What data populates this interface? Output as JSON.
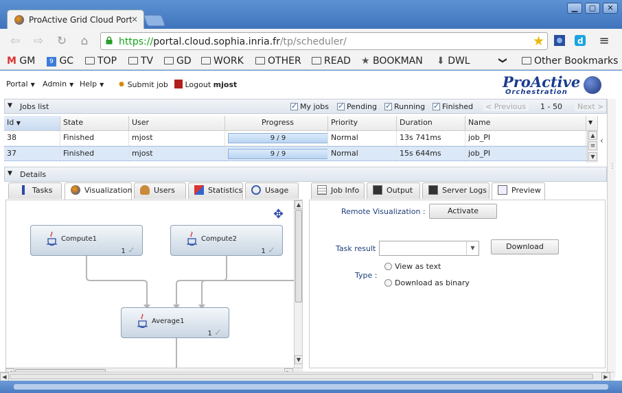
{
  "browser": {
    "tab_title": "ProActive Grid Cloud Port",
    "tab_close": "×",
    "url_scheme": "https://",
    "url_host": "portal.cloud.sophia.inria.fr",
    "url_path": "/tp/scheduler/",
    "window_buttons": [
      "▁",
      "▢",
      "✕"
    ],
    "nav": {
      "back": "⇦",
      "forward": "⇨",
      "reload": "↻",
      "home": "⌂"
    },
    "menu_icon": "≡",
    "bookmarks": [
      {
        "label": "GM",
        "icon": "gmail-icon"
      },
      {
        "label": "GC",
        "icon": "calendar-icon"
      },
      {
        "label": "TOP",
        "icon": "folder-icon"
      },
      {
        "label": "TV",
        "icon": "folder-icon"
      },
      {
        "label": "GD",
        "icon": "folder-icon"
      },
      {
        "label": "WORK",
        "icon": "folder-icon"
      },
      {
        "label": "OTHER",
        "icon": "folder-icon"
      },
      {
        "label": "READ",
        "icon": "folder-icon"
      },
      {
        "label": "BOOKMAN",
        "icon": "star-icon"
      },
      {
        "label": "DWL",
        "icon": "download-icon"
      }
    ],
    "bookmarks_overflow": "❯",
    "other_bookmarks": "Other Bookmarks"
  },
  "menu": {
    "portal": "Portal",
    "admin": "Admin",
    "help": "Help",
    "submit_job": "Submit job",
    "logout": "Logout",
    "user": "mjost",
    "logo_line1": "ProActive",
    "logo_line2": "Orchestration"
  },
  "jobs_list": {
    "title": "Jobs list",
    "collapse_icon": "chevron-down-icon",
    "filters": {
      "my_jobs": "My jobs",
      "pending": "Pending",
      "running": "Running",
      "finished": "Finished"
    },
    "previous": "< Previous",
    "range": "1 - 50",
    "next": "Next >",
    "columns": {
      "id": "Id",
      "state": "State",
      "user": "User",
      "progress": "Progress",
      "priority": "Priority",
      "duration": "Duration",
      "name": "Name"
    },
    "rows": [
      {
        "id": "38",
        "state": "Finished",
        "user": "mjost",
        "progress": "9 / 9",
        "progress_fraction": 1.0,
        "priority": "Normal",
        "duration": "13s 741ms",
        "name": "job_PI"
      },
      {
        "id": "37",
        "state": "Finished",
        "user": "mjost",
        "progress": "9 / 9",
        "progress_fraction": 1.0,
        "priority": "Normal",
        "duration": "15s 644ms",
        "name": "job_PI"
      }
    ]
  },
  "details": {
    "title": "Details",
    "left_tabs": [
      "Tasks",
      "Visualization",
      "Users",
      "Statistics",
      "Usage"
    ],
    "right_tabs": [
      "Job Info",
      "Output",
      "Server Logs",
      "Preview"
    ],
    "tasks": [
      {
        "name": "Compute1",
        "count": "1"
      },
      {
        "name": "Compute2",
        "count": "1"
      },
      {
        "name": "Average1",
        "count": "1"
      }
    ],
    "tick": "✓",
    "preview": {
      "remote_label": "Remote Visualization :",
      "activate": "Activate",
      "task_result_label": "Task result :",
      "download": "Download",
      "type_label": "Type :",
      "view_as_text": "View as text",
      "download_binary": "Download as binary"
    }
  },
  "colors": {
    "accent": "#3f74bc",
    "selected_row": "#dbe8f8",
    "link_blue": "#1d3f79"
  }
}
